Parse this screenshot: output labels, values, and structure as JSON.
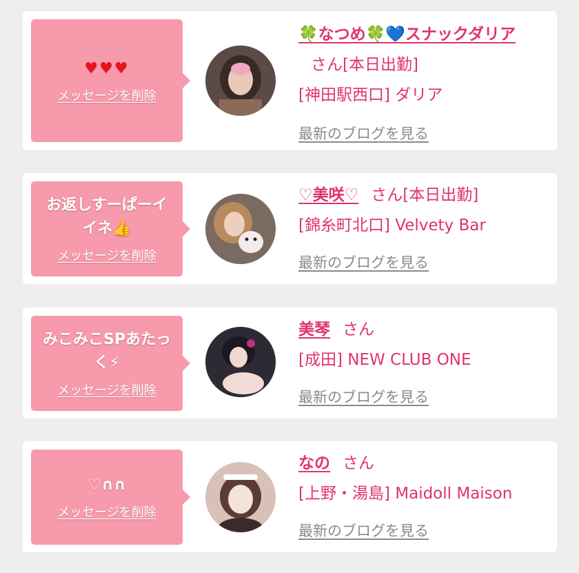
{
  "delete_label": "メッセージを削除",
  "blog_label": "最新のブログを見る",
  "san_label": "さん",
  "cards": [
    {
      "message": "♥♥♥",
      "name_prefix": "🍀",
      "name_main": "なつめ",
      "name_mid": "🍀",
      "name_heart": "💙",
      "name_shop": "スナックダリア",
      "status": "[本日出勤]",
      "location": "[神田駅西口] ダリア",
      "avatar_icon": "avatar-natsume"
    },
    {
      "message": "お返しすーぱーイイネ👍",
      "name": "♡美咲♡",
      "status": "[本日出勤]",
      "location": "[錦糸町北口] Velvety Bar",
      "avatar_icon": "avatar-misaki"
    },
    {
      "message": "みこみこSPあたっく⚡",
      "name": "美琴",
      "status": "",
      "location": "[成田] NEW CLUB ONE",
      "avatar_icon": "avatar-mikoto"
    },
    {
      "message": "♡∩∩",
      "name": "なの",
      "status": "",
      "location": "[上野・湯島] Maidoll Maison",
      "avatar_icon": "avatar-nano"
    }
  ]
}
